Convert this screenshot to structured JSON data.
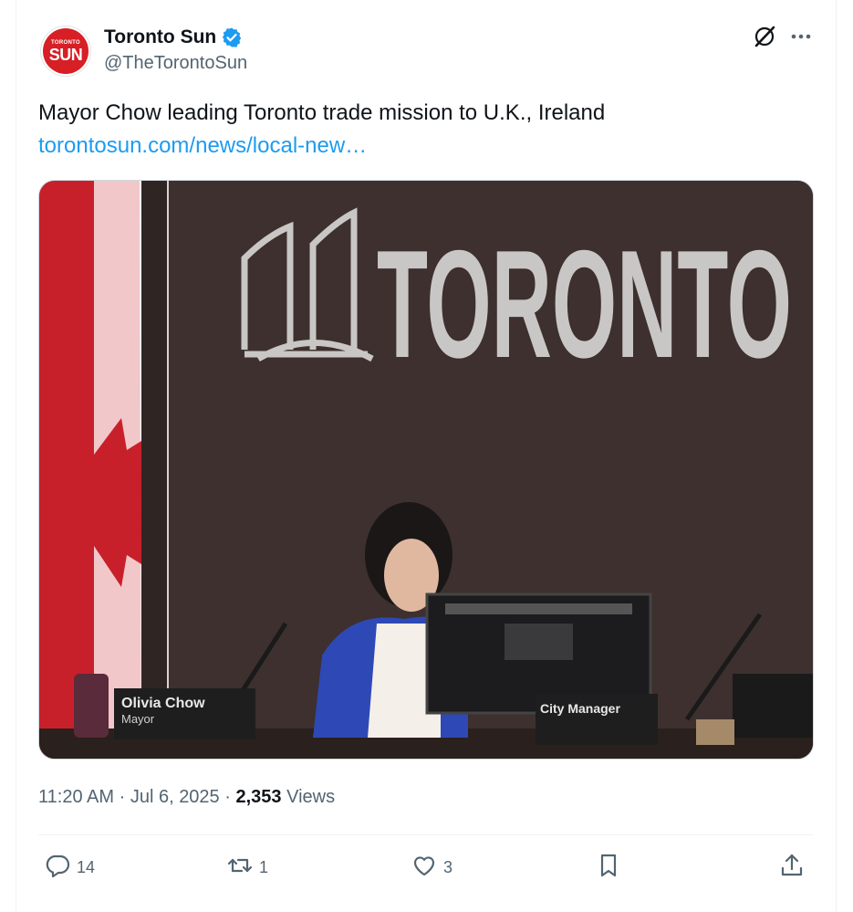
{
  "account": {
    "display_name": "Toronto Sun",
    "handle": "@TheTorontoSun",
    "avatar_top": "TORONTO",
    "avatar_main": "SUN",
    "verified_color": "#1d9bf0"
  },
  "tweet": {
    "text": "Mayor Chow leading Toronto trade mission to U.K., Ireland",
    "link": "torontosun.com/news/local-new…"
  },
  "media": {
    "wall_sign": "TORONTO",
    "nameplate_name": "Olivia Chow",
    "nameplate_title": "Mayor",
    "nameplate_right": "City Manager"
  },
  "meta": {
    "time": "11:20 AM",
    "separator": "·",
    "date": "Jul 6, 2025",
    "views_count": "2,353",
    "views_label": "Views"
  },
  "actions": {
    "replies": "14",
    "reposts": "1",
    "likes": "3"
  },
  "icons": [
    "verified-badge-icon",
    "grok-icon",
    "more-icon",
    "reply-icon",
    "repost-icon",
    "like-icon",
    "bookmark-icon",
    "share-icon"
  ],
  "colors": {
    "link": "#1d9bf0",
    "secondary_text": "#536471",
    "primary_text": "#0f1419"
  }
}
